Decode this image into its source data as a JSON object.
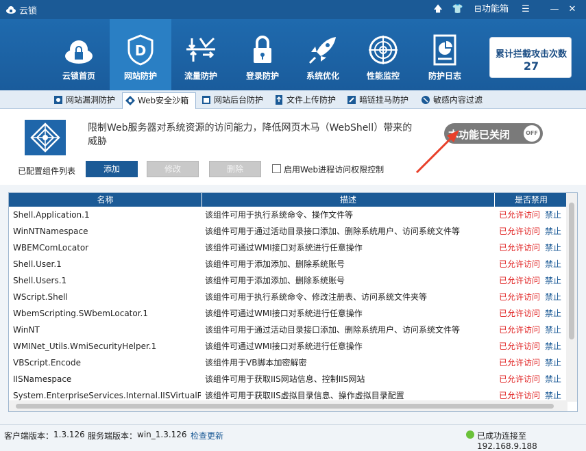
{
  "window": {
    "title": "云锁"
  },
  "titlebar_controls": {
    "toolbox_label": "功能箱"
  },
  "nav": [
    {
      "label": "云锁首页",
      "icon": "cloud-lock-icon",
      "active": false
    },
    {
      "label": "网站防护",
      "icon": "shield-d-icon",
      "active": true
    },
    {
      "label": "流量防护",
      "icon": "traffic-icon",
      "active": false
    },
    {
      "label": "登录防护",
      "icon": "padlock-icon",
      "active": false
    },
    {
      "label": "系统优化",
      "icon": "rocket-icon",
      "active": false
    },
    {
      "label": "性能监控",
      "icon": "radar-icon",
      "active": false
    },
    {
      "label": "防护日志",
      "icon": "log-document-icon",
      "active": false
    }
  ],
  "counter": {
    "title": "累计拦截攻击次数",
    "value": "27"
  },
  "subtabs": [
    {
      "label": "网站漏洞防护",
      "active": false
    },
    {
      "label": "Web安全沙箱",
      "active": true
    },
    {
      "label": "网站后台防护",
      "active": false
    },
    {
      "label": "文件上传防护",
      "active": false
    },
    {
      "label": "暗链挂马防护",
      "active": false
    },
    {
      "label": "敏感内容过滤",
      "active": false
    }
  ],
  "panel": {
    "description": "限制Web服务器对系统资源的访问能力，降低网页木马（WebShell）带来的威胁",
    "toggle_label": "本功能已关闭",
    "toggle_state": "OFF",
    "list_label": "已配置组件列表",
    "add_button": "添加",
    "edit_button": "修改",
    "delete_button": "删除",
    "checkbox_label": "启用Web进程访问权限控制"
  },
  "table": {
    "headers": [
      "名称",
      "描述",
      "是否禁用"
    ],
    "rows": [
      {
        "name": "Shell.Application.1",
        "desc": "该组件可用于执行系统命令、操作文件等",
        "allow": "已允许访问",
        "deny": "禁止"
      },
      {
        "name": "WinNTNamespace",
        "desc": "该组件可用于通过活动目录接口添加、删除系统用户、访问系统文件等",
        "allow": "已允许访问",
        "deny": "禁止"
      },
      {
        "name": "WBEMComLocator",
        "desc": "该组件可通过WMI接口对系统进行任意操作",
        "allow": "已允许访问",
        "deny": "禁止"
      },
      {
        "name": "Shell.User.1",
        "desc": "该组件可用于添加添加、删除系统账号",
        "allow": "已允许访问",
        "deny": "禁止"
      },
      {
        "name": "Shell.Users.1",
        "desc": "该组件可用于添加添加、删除系统账号",
        "allow": "已允许访问",
        "deny": "禁止"
      },
      {
        "name": "WScript.Shell",
        "desc": "该组件可用于执行系统命令、修改注册表、访问系统文件夹等",
        "allow": "已允许访问",
        "deny": "禁止"
      },
      {
        "name": "WbemScripting.SWbemLocator.1",
        "desc": "该组件可通过WMI接口对系统进行任意操作",
        "allow": "已允许访问",
        "deny": "禁止"
      },
      {
        "name": "WinNT",
        "desc": "该组件可用于通过活动目录接口添加、删除系统用户、访问系统文件等",
        "allow": "已允许访问",
        "deny": "禁止"
      },
      {
        "name": "WMINet_Utils.WmiSecurityHelper.1",
        "desc": "该组件可通过WMI接口对系统进行任意操作",
        "allow": "已允许访问",
        "deny": "禁止"
      },
      {
        "name": "VBScript.Encode",
        "desc": "该组件用于VB脚本加密解密",
        "allow": "已允许访问",
        "deny": "禁止"
      },
      {
        "name": "IISNamespace",
        "desc": "该组件可用于获取IIS网站信息、控制IIS网站",
        "allow": "已允许访问",
        "deny": "禁止"
      },
      {
        "name": "System.EnterpriseServices.Internal.IISVirtualRoot",
        "desc": "该组件可用于获取IIS虚拟目录信息、操作虚拟目录配置",
        "allow": "已允许访问",
        "deny": "禁止"
      }
    ]
  },
  "status": {
    "client_version_label": "客户端版本：",
    "client_version": "1.3.126",
    "server_version_label": "服务端版本：",
    "server_version": "win_1.3.126",
    "check_update": "检查更新",
    "connection": "已成功连接至 192.168.9.188"
  },
  "colors": {
    "primary": "#1b5a96",
    "allow": "#e02020",
    "annotation_arrow": "#e8402a",
    "connected": "#6bc23a"
  }
}
